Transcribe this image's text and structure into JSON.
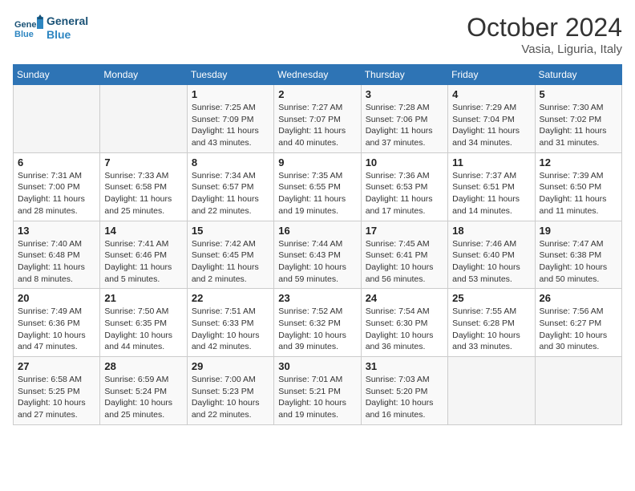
{
  "header": {
    "logo_general": "General",
    "logo_blue": "Blue",
    "title": "October 2024",
    "location": "Vasia, Liguria, Italy"
  },
  "days_of_week": [
    "Sunday",
    "Monday",
    "Tuesday",
    "Wednesday",
    "Thursday",
    "Friday",
    "Saturday"
  ],
  "weeks": [
    [
      {
        "day": "",
        "info": ""
      },
      {
        "day": "",
        "info": ""
      },
      {
        "day": "1",
        "info": "Sunrise: 7:25 AM\nSunset: 7:09 PM\nDaylight: 11 hours and 43 minutes."
      },
      {
        "day": "2",
        "info": "Sunrise: 7:27 AM\nSunset: 7:07 PM\nDaylight: 11 hours and 40 minutes."
      },
      {
        "day": "3",
        "info": "Sunrise: 7:28 AM\nSunset: 7:06 PM\nDaylight: 11 hours and 37 minutes."
      },
      {
        "day": "4",
        "info": "Sunrise: 7:29 AM\nSunset: 7:04 PM\nDaylight: 11 hours and 34 minutes."
      },
      {
        "day": "5",
        "info": "Sunrise: 7:30 AM\nSunset: 7:02 PM\nDaylight: 11 hours and 31 minutes."
      }
    ],
    [
      {
        "day": "6",
        "info": "Sunrise: 7:31 AM\nSunset: 7:00 PM\nDaylight: 11 hours and 28 minutes."
      },
      {
        "day": "7",
        "info": "Sunrise: 7:33 AM\nSunset: 6:58 PM\nDaylight: 11 hours and 25 minutes."
      },
      {
        "day": "8",
        "info": "Sunrise: 7:34 AM\nSunset: 6:57 PM\nDaylight: 11 hours and 22 minutes."
      },
      {
        "day": "9",
        "info": "Sunrise: 7:35 AM\nSunset: 6:55 PM\nDaylight: 11 hours and 19 minutes."
      },
      {
        "day": "10",
        "info": "Sunrise: 7:36 AM\nSunset: 6:53 PM\nDaylight: 11 hours and 17 minutes."
      },
      {
        "day": "11",
        "info": "Sunrise: 7:37 AM\nSunset: 6:51 PM\nDaylight: 11 hours and 14 minutes."
      },
      {
        "day": "12",
        "info": "Sunrise: 7:39 AM\nSunset: 6:50 PM\nDaylight: 11 hours and 11 minutes."
      }
    ],
    [
      {
        "day": "13",
        "info": "Sunrise: 7:40 AM\nSunset: 6:48 PM\nDaylight: 11 hours and 8 minutes."
      },
      {
        "day": "14",
        "info": "Sunrise: 7:41 AM\nSunset: 6:46 PM\nDaylight: 11 hours and 5 minutes."
      },
      {
        "day": "15",
        "info": "Sunrise: 7:42 AM\nSunset: 6:45 PM\nDaylight: 11 hours and 2 minutes."
      },
      {
        "day": "16",
        "info": "Sunrise: 7:44 AM\nSunset: 6:43 PM\nDaylight: 10 hours and 59 minutes."
      },
      {
        "day": "17",
        "info": "Sunrise: 7:45 AM\nSunset: 6:41 PM\nDaylight: 10 hours and 56 minutes."
      },
      {
        "day": "18",
        "info": "Sunrise: 7:46 AM\nSunset: 6:40 PM\nDaylight: 10 hours and 53 minutes."
      },
      {
        "day": "19",
        "info": "Sunrise: 7:47 AM\nSunset: 6:38 PM\nDaylight: 10 hours and 50 minutes."
      }
    ],
    [
      {
        "day": "20",
        "info": "Sunrise: 7:49 AM\nSunset: 6:36 PM\nDaylight: 10 hours and 47 minutes."
      },
      {
        "day": "21",
        "info": "Sunrise: 7:50 AM\nSunset: 6:35 PM\nDaylight: 10 hours and 44 minutes."
      },
      {
        "day": "22",
        "info": "Sunrise: 7:51 AM\nSunset: 6:33 PM\nDaylight: 10 hours and 42 minutes."
      },
      {
        "day": "23",
        "info": "Sunrise: 7:52 AM\nSunset: 6:32 PM\nDaylight: 10 hours and 39 minutes."
      },
      {
        "day": "24",
        "info": "Sunrise: 7:54 AM\nSunset: 6:30 PM\nDaylight: 10 hours and 36 minutes."
      },
      {
        "day": "25",
        "info": "Sunrise: 7:55 AM\nSunset: 6:28 PM\nDaylight: 10 hours and 33 minutes."
      },
      {
        "day": "26",
        "info": "Sunrise: 7:56 AM\nSunset: 6:27 PM\nDaylight: 10 hours and 30 minutes."
      }
    ],
    [
      {
        "day": "27",
        "info": "Sunrise: 6:58 AM\nSunset: 5:25 PM\nDaylight: 10 hours and 27 minutes."
      },
      {
        "day": "28",
        "info": "Sunrise: 6:59 AM\nSunset: 5:24 PM\nDaylight: 10 hours and 25 minutes."
      },
      {
        "day": "29",
        "info": "Sunrise: 7:00 AM\nSunset: 5:23 PM\nDaylight: 10 hours and 22 minutes."
      },
      {
        "day": "30",
        "info": "Sunrise: 7:01 AM\nSunset: 5:21 PM\nDaylight: 10 hours and 19 minutes."
      },
      {
        "day": "31",
        "info": "Sunrise: 7:03 AM\nSunset: 5:20 PM\nDaylight: 10 hours and 16 minutes."
      },
      {
        "day": "",
        "info": ""
      },
      {
        "day": "",
        "info": ""
      }
    ]
  ]
}
